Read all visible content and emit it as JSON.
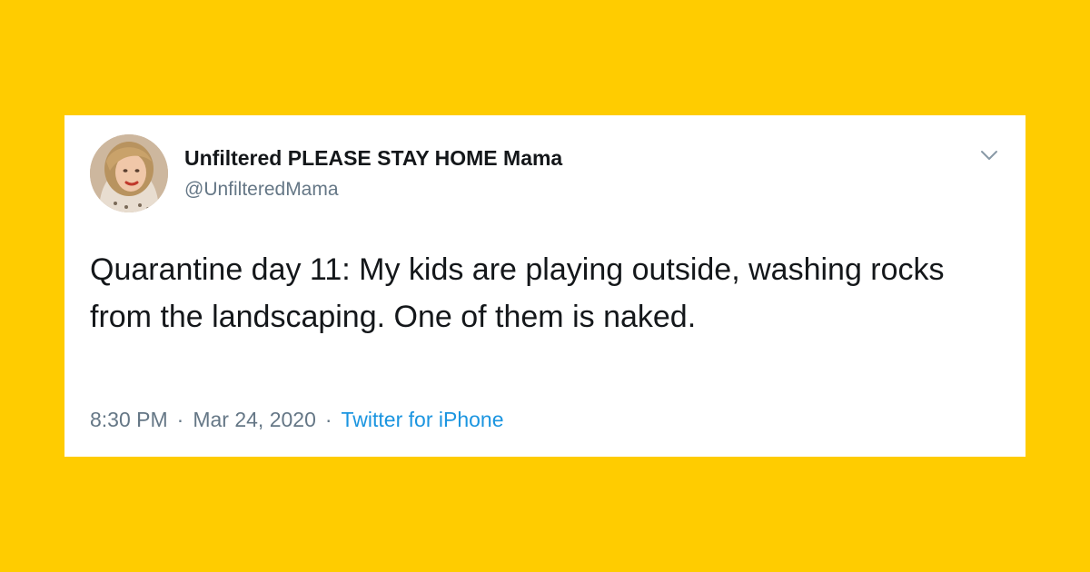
{
  "colors": {
    "background": "#FFCC00",
    "card": "#FFFFFF",
    "text_primary": "#14171A",
    "text_secondary": "#657786",
    "link": "#1B95E0"
  },
  "tweet": {
    "author": {
      "display_name": "Unfiltered PLEASE STAY HOME Mama",
      "handle": "@UnfilteredMama",
      "avatar_icon": "profile-photo"
    },
    "menu_icon": "chevron-down-icon",
    "text": "Quarantine day 11: My kids are playing outside, washing rocks from the landscaping. One of them is naked.",
    "time": "8:30 PM",
    "date": "Mar 24, 2020",
    "separator": "·",
    "source": "Twitter for iPhone"
  }
}
